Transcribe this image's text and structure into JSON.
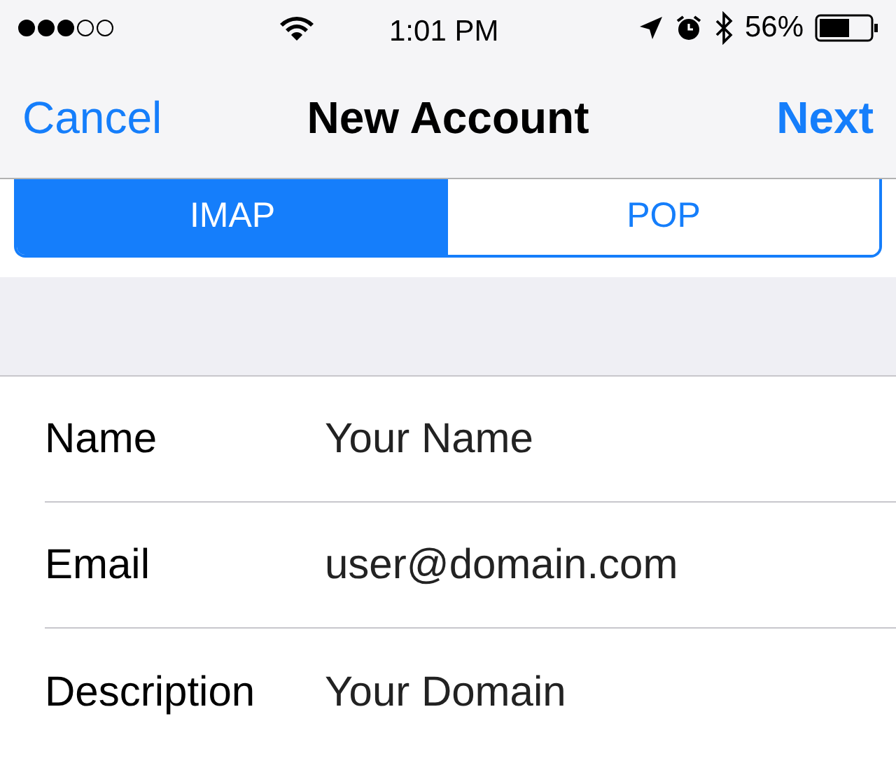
{
  "status_bar": {
    "time": "1:01 PM",
    "battery": "56%"
  },
  "nav": {
    "cancel": "Cancel",
    "title": "New Account",
    "next": "Next"
  },
  "segments": [
    {
      "label": "IMAP",
      "selected": true
    },
    {
      "label": "POP",
      "selected": false
    }
  ],
  "fields": [
    {
      "label": "Name",
      "value": "Your Name"
    },
    {
      "label": "Email",
      "value": "user@domain.com"
    },
    {
      "label": "Description",
      "value": "Your Domain"
    }
  ]
}
